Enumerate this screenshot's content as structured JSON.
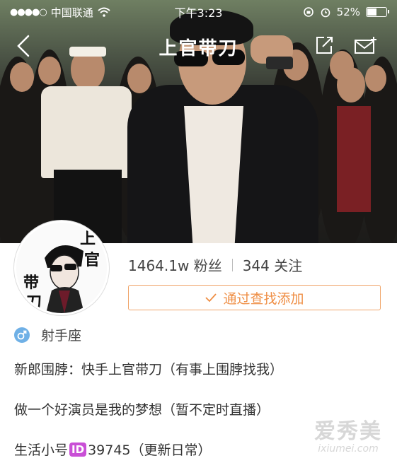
{
  "status_bar": {
    "signal": "●●●●○",
    "carrier": "中国联通",
    "time": "下午3:23",
    "battery_percent": "52%",
    "battery_level": 0.52
  },
  "nav": {
    "title": "上官带刀",
    "back_icon": "chevron-left-icon",
    "share_icon": "share-icon",
    "message_icon": "mail-add-icon"
  },
  "profile": {
    "avatar_text": [
      "上",
      "官",
      "带",
      "刀"
    ],
    "fans_count": "1464.1w",
    "fans_label": "粉丝",
    "following_count": "344",
    "following_label": "关注",
    "add_button_label": "通过查找添加",
    "gender_icon": "male-icon",
    "constellation": "射手座"
  },
  "bio": {
    "line1": "新郎围脖：快手上官带刀（有事上围脖找我）",
    "line2": "做一个好演员是我的梦想（暂不定时直播）",
    "line3_prefix": "生活小号",
    "line3_badge": "ID",
    "line3_suffix": "39745（更新日常）"
  },
  "watermark": {
    "cn": "爱秀美",
    "en": "ixiumei.com"
  },
  "colors": {
    "accent_orange": "#ef8e44",
    "id_badge": "#c94fd6",
    "gender_blue": "#6fb0e6"
  }
}
